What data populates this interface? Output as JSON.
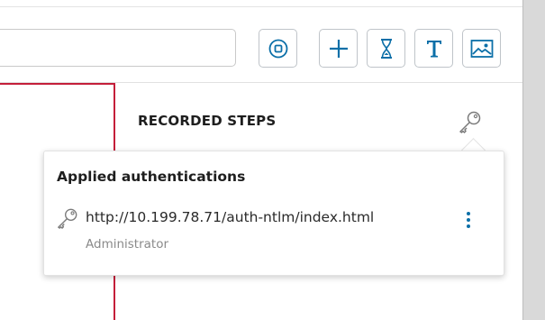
{
  "toolbar": {
    "url_input_value": "",
    "buttons": [
      {
        "icon": "stop-record-icon"
      },
      {
        "icon": "plus-icon"
      },
      {
        "icon": "hourglass-icon"
      },
      {
        "icon": "text-icon",
        "glyph": "T"
      },
      {
        "icon": "image-icon"
      }
    ],
    "accent_color": "#0b6fa8"
  },
  "canvas": {
    "border_color": "#c41e3a"
  },
  "steps_panel": {
    "title": "RECORDED STEPS",
    "auth_icon": "key-icon"
  },
  "auth_popover": {
    "title": "Applied authentications",
    "items": [
      {
        "icon": "key-icon",
        "url": "http://10.199.78.71/auth-ntlm/index.html",
        "username": "Administrator",
        "menu_icon": "more-vertical-icon"
      }
    ]
  }
}
